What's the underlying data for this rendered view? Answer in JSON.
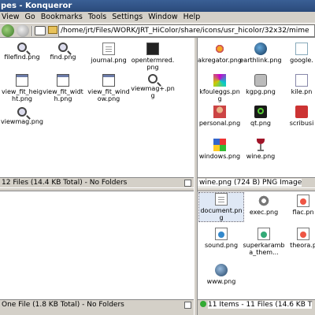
{
  "window": {
    "title": "pes - Konqueror"
  },
  "menu": [
    {
      "label": "View",
      "u": "V"
    },
    {
      "label": "Go",
      "u": "G"
    },
    {
      "label": "Bookmarks",
      "u": "B"
    },
    {
      "label": "Tools",
      "u": "T"
    },
    {
      "label": "Settings",
      "u": "S"
    },
    {
      "label": "Window",
      "u": "W"
    },
    {
      "label": "Help",
      "u": "H"
    }
  ],
  "location": {
    "value": "/home/jrt/Files/WORK/JRT_HiColor/share/icons/usr_hicolor/32x32/mime"
  },
  "panes": {
    "top_left": {
      "items": [
        "filefind.png",
        "find.png",
        "journal.png",
        "opentermred.png",
        "view_fit_height.png",
        "view_fit_width.png",
        "view_fit_window.png",
        "viewmag+.png",
        "viewmag.png"
      ],
      "status": "12 Files (14.4 KB Total) - No Folders"
    },
    "top_right": {
      "items": [
        "akregator.png",
        "earthlink.png",
        "google.",
        "kfouleggs.png",
        "kgpg.png",
        "kile.pn",
        "personal.png",
        "qt.png",
        "scribusi",
        "windows.png",
        "wine.png"
      ],
      "status": "wine.png (724 B)  PNG Image"
    },
    "bottom_left": {
      "status": "One File (1.8 KB Total) - No Folders"
    },
    "bottom_right": {
      "items": [
        "document.png",
        "exec.png",
        "flac.pn",
        "sound.png",
        "superkaramba_them...",
        "theora.p",
        "www.png"
      ],
      "status": "11 Items - 11 Files (14.6 KB T"
    }
  },
  "colors": {
    "titlebar": "#2f5288",
    "selection": "#dfe8f5"
  }
}
